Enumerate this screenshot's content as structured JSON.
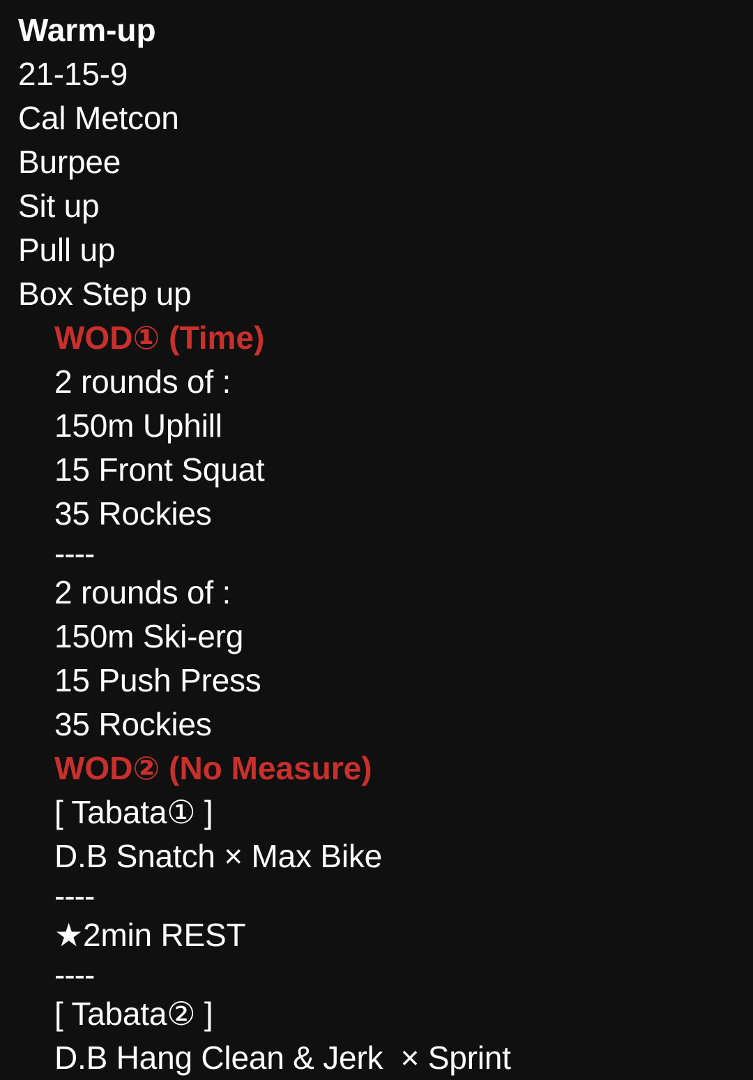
{
  "meta": {
    "background_color": "#101010",
    "text_color": "#ffffff",
    "accent_color": "#c9302c"
  },
  "warmup": {
    "heading": "Warm-up",
    "items": [
      "21-15-9",
      "Cal Metcon",
      "Burpee",
      "Sit up",
      "Pull up",
      "Box Step up"
    ]
  },
  "wod1": {
    "heading": "WOD① (Time)",
    "blockA": [
      "2 rounds of :",
      "150m Uphill",
      "15 Front Squat",
      "35 Rockies"
    ],
    "separator": "----",
    "blockB": [
      "2 rounds of :",
      "150m Ski-erg",
      "15 Push Press",
      "35 Rockies"
    ]
  },
  "wod2": {
    "heading": "WOD② (No Measure)",
    "tabata1_label": "[ Tabata① ]",
    "tabata1_content": "D.B Snatch × Max Bike",
    "separator1": "----",
    "rest": "★2min REST",
    "separator2": "----",
    "tabata2_label": "[ Tabata② ]",
    "tabata2_content": "D.B Hang Clean & Jerk  × Sprint"
  }
}
